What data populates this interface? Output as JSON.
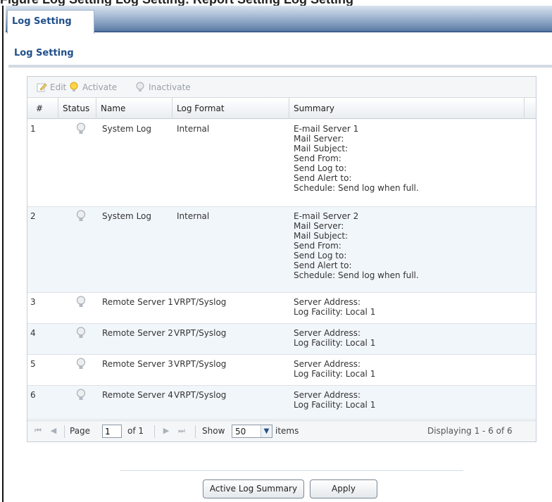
{
  "caption": "Figure Log Setting  Log Setting: Report Setting  Log Setting",
  "tab": {
    "label": "Log Setting"
  },
  "section_title": "Log Setting",
  "toolbar": {
    "edit": "Edit",
    "activate": "Activate",
    "inactivate": "Inactivate"
  },
  "columns": [
    "#",
    "Status",
    "Name",
    "Log Format",
    "Summary"
  ],
  "rows": [
    {
      "num": "1",
      "name": "System Log",
      "format": "Internal",
      "summary": [
        "E-mail Server 1",
        "Mail Server:",
        "Mail Subject:",
        "Send From:",
        "Send Log to:",
        "Send Alert to:",
        "Schedule: Send log when full."
      ]
    },
    {
      "num": "2",
      "name": "System Log",
      "format": "Internal",
      "summary": [
        "E-mail Server 2",
        "Mail Server:",
        "Mail Subject:",
        "Send From:",
        "Send Log to:",
        "Send Alert to:",
        "Schedule: Send log when full."
      ]
    },
    {
      "num": "3",
      "name": "Remote Server 1",
      "format": "VRPT/Syslog",
      "summary": [
        "Server Address:",
        "Log Facility: Local 1"
      ]
    },
    {
      "num": "4",
      "name": "Remote Server 2",
      "format": "VRPT/Syslog",
      "summary": [
        "Server Address:",
        "Log Facility: Local 1"
      ]
    },
    {
      "num": "5",
      "name": "Remote Server 3",
      "format": "VRPT/Syslog",
      "summary": [
        "Server Address:",
        "Log Facility: Local 1"
      ]
    },
    {
      "num": "6",
      "name": "Remote Server 4",
      "format": "VRPT/Syslog",
      "summary": [
        "Server Address:",
        "Log Facility: Local 1"
      ]
    }
  ],
  "pager": {
    "page_label": "Page",
    "page_value": "1",
    "of_label": "of 1",
    "show_label": "Show",
    "show_value": "50",
    "items_label": "items",
    "displaying": "Displaying 1 - 6 of 6"
  },
  "buttons": {
    "summary": "Active Log Summary",
    "apply": "Apply"
  },
  "colors": {
    "accent": "#1f4f8a",
    "tab_bar": "#5b7aa3",
    "alt_row": "#f1f6fb"
  }
}
